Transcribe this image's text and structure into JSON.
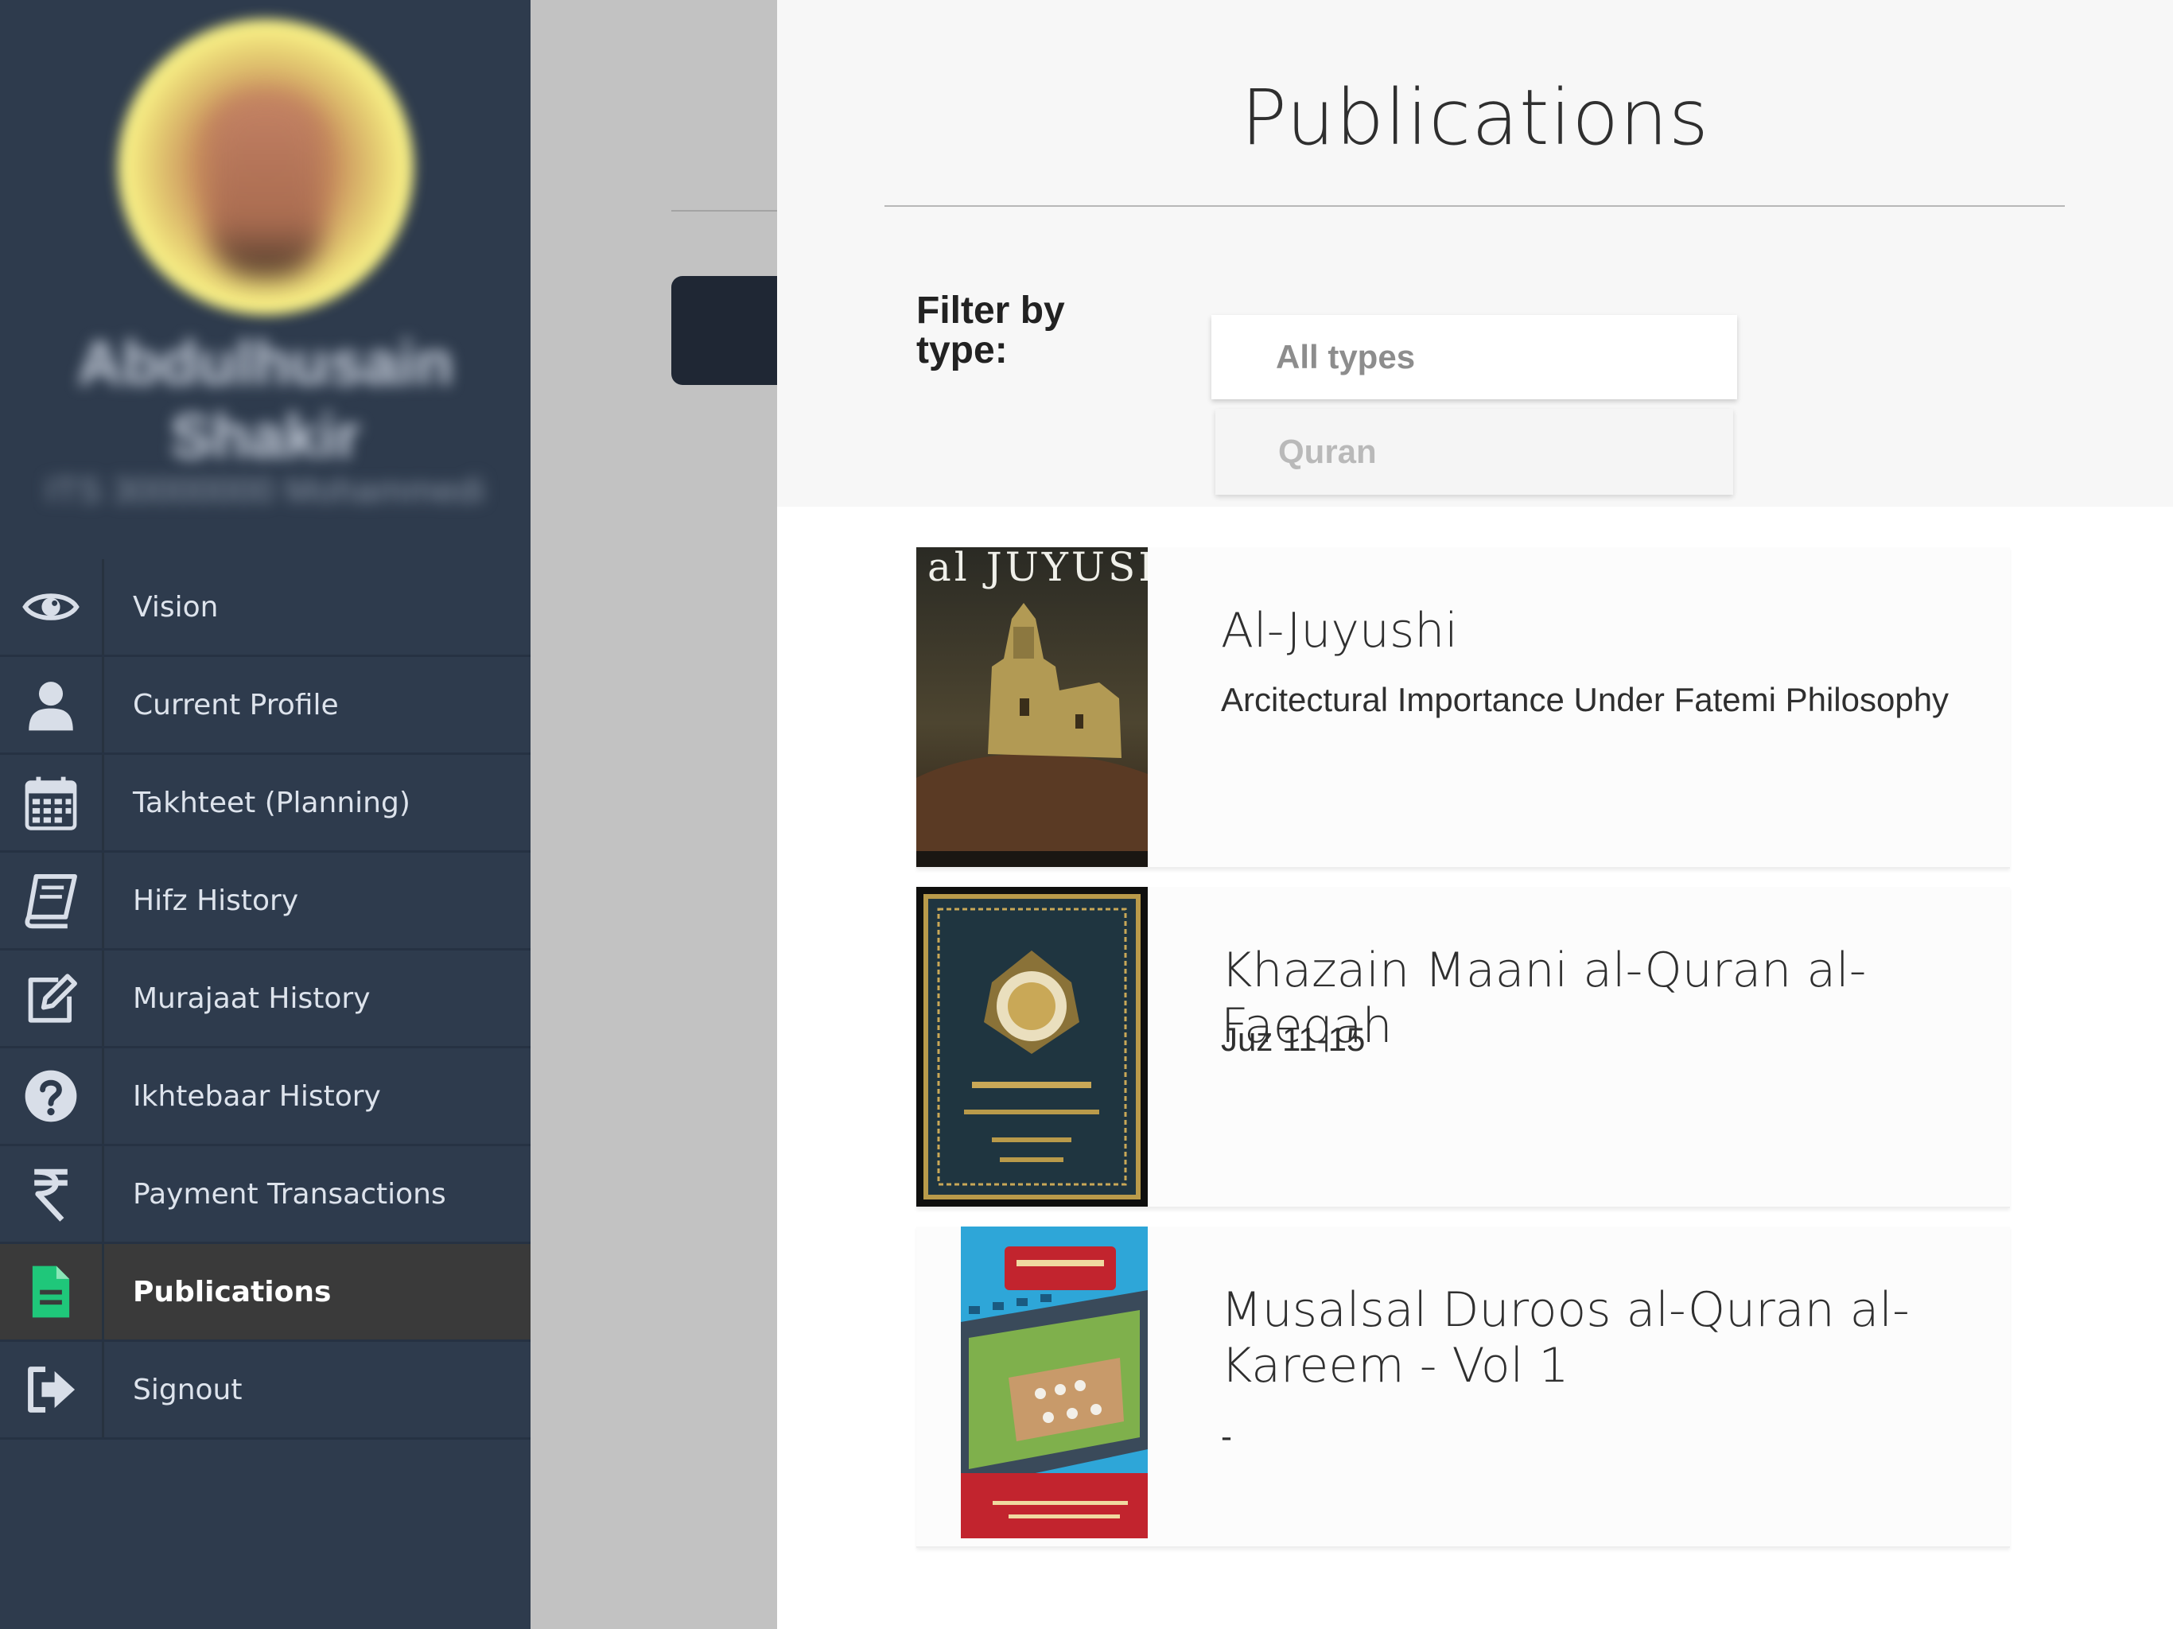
{
  "sidebar": {
    "profile": {
      "name": "Abdulhusain Shakir",
      "id": "ITS 30000000 Mohammedi"
    },
    "items": [
      {
        "label": "Vision",
        "icon": "eye-icon",
        "active": false
      },
      {
        "label": "Current Profile",
        "icon": "user-icon",
        "active": false
      },
      {
        "label": "Takhteet (Planning)",
        "icon": "calendar-icon",
        "active": false
      },
      {
        "label": "Hifz History",
        "icon": "book-icon",
        "active": false
      },
      {
        "label": "Murajaat History",
        "icon": "edit-icon",
        "active": false
      },
      {
        "label": "Ikhtebaar History",
        "icon": "question-circle-icon",
        "active": false
      },
      {
        "label": "Payment Transactions",
        "icon": "rupee-icon",
        "active": false
      },
      {
        "label": "Publications",
        "icon": "document-icon",
        "active": true
      },
      {
        "label": "Signout",
        "icon": "signout-icon",
        "active": false
      }
    ]
  },
  "publications": {
    "title": "Publications",
    "filter": {
      "label": "Filter by type:",
      "selected": "All types",
      "options": [
        "Quran"
      ]
    },
    "items": [
      {
        "title": "Al-Juyushi",
        "subtitle": "Arcitectural Importance Under Fatemi Philosophy",
        "cover_text": "al JUYUSHI"
      },
      {
        "title": "Khazain Maani al-Quran al-Faeqah",
        "subtitle": "Juz 11-15"
      },
      {
        "title": "Musalsal Duroos al-Quran al-Kareem - Vol 1",
        "subtitle": "-"
      }
    ]
  },
  "colors": {
    "sidebar_bg": "#2e3b4d",
    "active_item_bg": "#3a3a3a",
    "active_icon": "#1fc77a",
    "panel_bg": "#ffffff"
  }
}
